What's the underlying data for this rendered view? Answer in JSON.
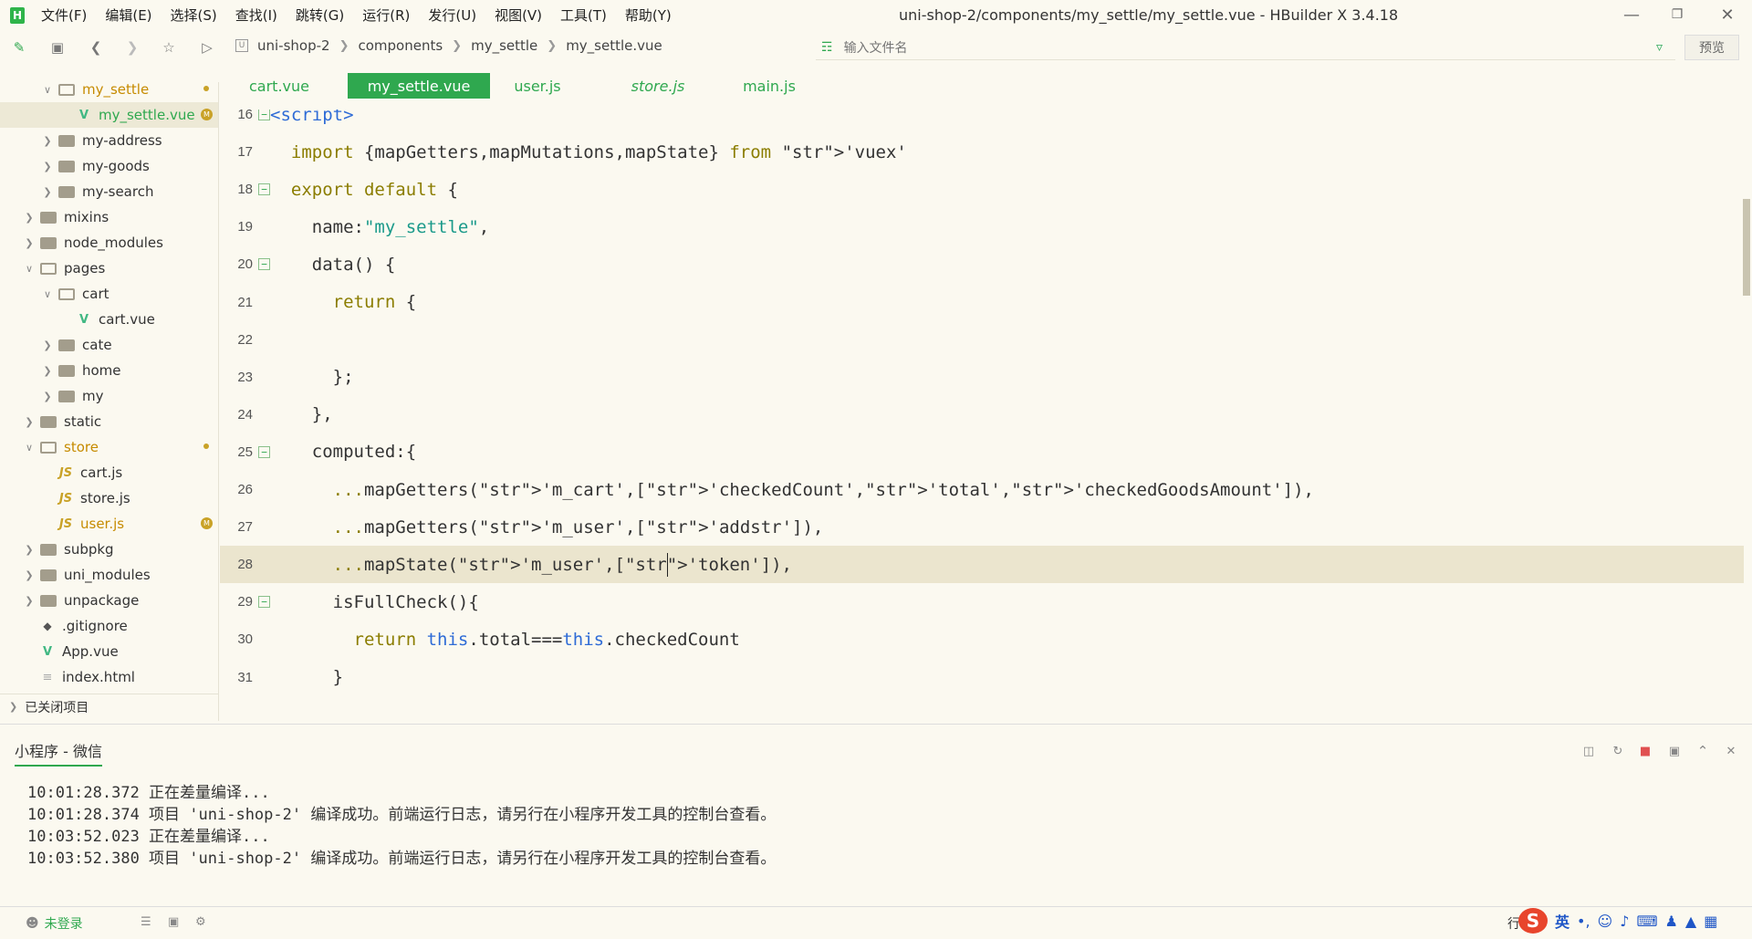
{
  "menu": [
    "文件(F)",
    "编辑(E)",
    "选择(S)",
    "查找(I)",
    "跳转(G)",
    "运行(R)",
    "发行(U)",
    "视图(V)",
    "工具(T)",
    "帮助(Y)"
  ],
  "window_title": "uni-shop-2/components/my_settle/my_settle.vue - HBuilder X 3.4.18",
  "breadcrumb": [
    "uni-shop-2",
    "components",
    "my_settle",
    "my_settle.vue"
  ],
  "file_search": {
    "placeholder": "输入文件名"
  },
  "preview_label": "预览",
  "tree": [
    {
      "label": "my_settle",
      "type": "folder-open",
      "depth": 2,
      "expanded": true,
      "status": "dot",
      "modified": true
    },
    {
      "label": "my_settle.vue",
      "type": "vue",
      "depth": 3,
      "status": "M",
      "modified": true,
      "selected": true
    },
    {
      "label": "my-address",
      "type": "folder",
      "depth": 2
    },
    {
      "label": "my-goods",
      "type": "folder",
      "depth": 2
    },
    {
      "label": "my-search",
      "type": "folder",
      "depth": 2
    },
    {
      "label": "mixins",
      "type": "folder",
      "depth": 1
    },
    {
      "label": "node_modules",
      "type": "folder",
      "depth": 1
    },
    {
      "label": "pages",
      "type": "folder-open",
      "depth": 1,
      "expanded": true
    },
    {
      "label": "cart",
      "type": "folder-open",
      "depth": 2,
      "expanded": true
    },
    {
      "label": "cart.vue",
      "type": "vue",
      "depth": 3
    },
    {
      "label": "cate",
      "type": "folder",
      "depth": 2
    },
    {
      "label": "home",
      "type": "folder",
      "depth": 2
    },
    {
      "label": "my",
      "type": "folder",
      "depth": 2
    },
    {
      "label": "static",
      "type": "folder",
      "depth": 1
    },
    {
      "label": "store",
      "type": "folder-open",
      "depth": 1,
      "expanded": true,
      "status": "dot",
      "modified": true
    },
    {
      "label": "cart.js",
      "type": "js",
      "depth": 2
    },
    {
      "label": "store.js",
      "type": "js",
      "depth": 2
    },
    {
      "label": "user.js",
      "type": "js",
      "depth": 2,
      "status": "M",
      "modified": true
    },
    {
      "label": "subpkg",
      "type": "folder",
      "depth": 1
    },
    {
      "label": "uni_modules",
      "type": "folder",
      "depth": 1
    },
    {
      "label": "unpackage",
      "type": "folder",
      "depth": 1
    },
    {
      "label": ".gitignore",
      "type": "git",
      "depth": 1
    },
    {
      "label": "App.vue",
      "type": "vue",
      "depth": 1
    },
    {
      "label": "index.html",
      "type": "file",
      "depth": 1
    }
  ],
  "closed_projects_label": "已关闭项目",
  "tabs": [
    {
      "label": "cart.vue",
      "active": false,
      "italic": false
    },
    {
      "label": "my_settle.vue",
      "active": true,
      "italic": false
    },
    {
      "label": "user.js",
      "active": false,
      "italic": false
    },
    {
      "label": "store.js",
      "active": false,
      "italic": true
    },
    {
      "label": "main.js",
      "active": false,
      "italic": false
    }
  ],
  "code_lines": [
    {
      "n": "16",
      "fold": true,
      "text": "<script>"
    },
    {
      "n": "17",
      "fold": false,
      "text": "  import {mapGetters,mapMutations,mapState} from 'vuex'"
    },
    {
      "n": "18",
      "fold": true,
      "text": "  export default {"
    },
    {
      "n": "19",
      "fold": false,
      "text": "    name:\"my_settle\","
    },
    {
      "n": "20",
      "fold": true,
      "text": "    data() {"
    },
    {
      "n": "21",
      "fold": false,
      "text": "      return {"
    },
    {
      "n": "22",
      "fold": false,
      "text": ""
    },
    {
      "n": "23",
      "fold": false,
      "text": "      };"
    },
    {
      "n": "24",
      "fold": false,
      "text": "    },"
    },
    {
      "n": "25",
      "fold": true,
      "text": "    computed:{"
    },
    {
      "n": "26",
      "fold": false,
      "text": "      ...mapGetters('m_cart',['checkedCount','total','checkedGoodsAmount']),"
    },
    {
      "n": "27",
      "fold": false,
      "text": "      ...mapGetters('m_user',['addstr']),"
    },
    {
      "n": "28",
      "fold": false,
      "text": "      ...mapState('m_user',['token']),",
      "current": true
    },
    {
      "n": "29",
      "fold": true,
      "text": "      isFullCheck(){"
    },
    {
      "n": "30",
      "fold": false,
      "text": "        return this.total===this.checkedCount"
    },
    {
      "n": "31",
      "fold": false,
      "text": "      }"
    }
  ],
  "output": {
    "tab_label": "小程序 - 微信",
    "logs": [
      "10:01:28.372 正在差量编译...",
      "10:01:28.374 项目 'uni-shop-2' 编译成功。前端运行日志，请另行在小程序开发工具的控制台查看。",
      "10:03:52.023 正在差量编译...",
      "10:03:52.380 项目 'uni-shop-2' 编译成功。前端运行日志，请另行在小程序开发工具的控制台查看。"
    ]
  },
  "status": {
    "login": "未登录",
    "row_label": "行",
    "ime_lang": "英"
  },
  "colors": {
    "accent": "#2fa84f",
    "background": "#fbf9f0",
    "keyword": "#8b7d00",
    "string": "#1b9a8a",
    "tag": "#2e6bd6",
    "modified": "#c68b00"
  }
}
